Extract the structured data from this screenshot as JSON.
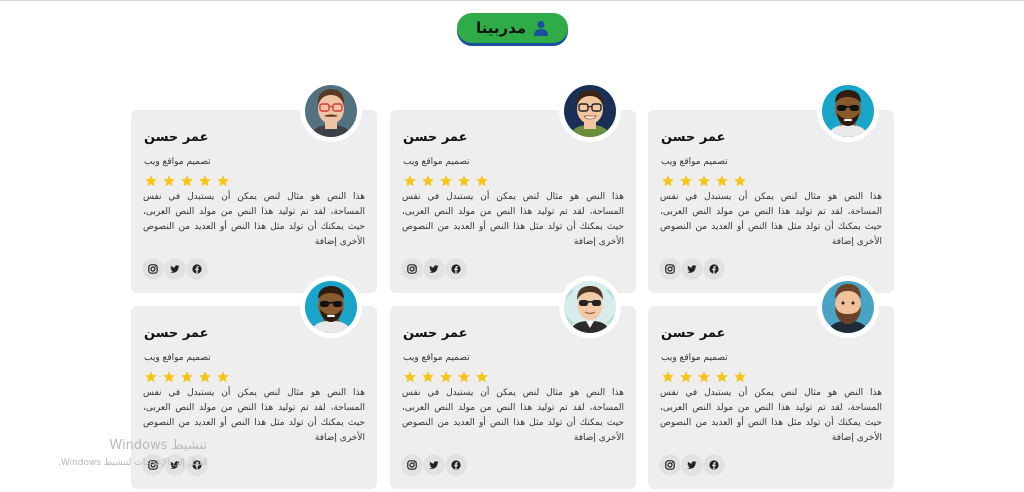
{
  "section": {
    "title": "مدربينا",
    "title_icon": "user-icon"
  },
  "colors": {
    "pill": "#2fab48",
    "pill_shadow": "#1d4fa0",
    "star": "#f5c518",
    "card": "#eeeeee"
  },
  "cards": [
    {
      "name": "عمر حسن",
      "role": "تصميم مواقع ويب",
      "rating": 5,
      "avatar": "avatar-man-sunglasses-beard",
      "desc": "هذا النص هو مثال لنص يمكن أن يستبدل في نفس المساحة، لقد تم توليد هذا النص من مولد النص العربى، حيث يمكنك أن تولد مثل هذا النص أو العديد من النصوص الأخرى إضافة"
    },
    {
      "name": "عمر حسن",
      "role": "تصميم مواقع ويب",
      "rating": 5,
      "avatar": "avatar-man-glasses-smile",
      "desc": "هذا النص هو مثال لنص يمكن أن يستبدل في نفس المساحة، لقد تم توليد هذا النص من مولد النص العربى، حيث يمكنك أن تولد مثل هذا النص أو العديد من النصوص الأخرى إضافة"
    },
    {
      "name": "عمر حسن",
      "role": "تصميم مواقع ويب",
      "rating": 5,
      "avatar": "avatar-man-glasses-mustache",
      "desc": "هذا النص هو مثال لنص يمكن أن يستبدل في نفس المساحة، لقد تم توليد هذا النص من مولد النص العربى، حيث يمكنك أن تولد مثل هذا النص أو العديد من النصوص الأخرى إضافة"
    },
    {
      "name": "عمر حسن",
      "role": "تصميم مواقع ويب",
      "rating": 5,
      "avatar": "avatar-man-beard",
      "desc": "هذا النص هو مثال لنص يمكن أن يستبدل في نفس المساحة، لقد تم توليد هذا النص من مولد النص العربى، حيث يمكنك أن تولد مثل هذا النص أو العديد من النصوص الأخرى إضافة"
    },
    {
      "name": "عمر حسن",
      "role": "تصميم مواقع ويب",
      "rating": 5,
      "avatar": "avatar-man-sunglasses-suit",
      "desc": "هذا النص هو مثال لنص يمكن أن يستبدل في نفس المساحة، لقد تم توليد هذا النص من مولد النص العربى، حيث يمكنك أن تولد مثل هذا النص أو العديد من النصوص الأخرى إضافة"
    },
    {
      "name": "عمر حسن",
      "role": "تصميم مواقع ويب",
      "rating": 5,
      "avatar": "avatar-man-sunglasses-beard",
      "desc": "هذا النص هو مثال لنص يمكن أن يستبدل في نفس المساحة، لقد تم توليد هذا النص من مولد النص العربى، حيث يمكنك أن تولد مثل هذا النص أو العديد من النصوص الأخرى إضافة"
    }
  ],
  "social_icons": [
    "facebook-icon",
    "twitter-icon",
    "instagram-icon"
  ],
  "watermark": {
    "line1": "تنشيط Windows",
    "line2": "انتقل إلى الإعدادات لتنشيط Windows."
  }
}
